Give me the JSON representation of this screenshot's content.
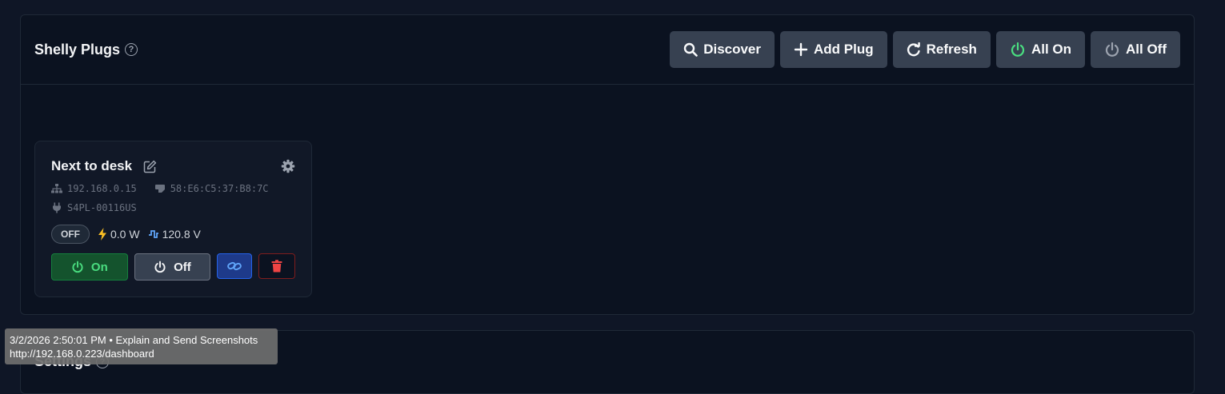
{
  "plugs_panel": {
    "title": "Shelly Plugs",
    "help": "?",
    "toolbar": {
      "discover": "Discover",
      "add_plug": "Add Plug",
      "refresh": "Refresh",
      "all_on": "All On",
      "all_off": "All Off"
    }
  },
  "plug": {
    "name": "Next to desk",
    "ip": "192.168.0.15",
    "mac": "58:E6:C5:37:B8:7C",
    "model": "S4PL-00116US",
    "state": "OFF",
    "power": "0.0 W",
    "voltage": "120.8 V",
    "on_label": "On",
    "off_label": "Off"
  },
  "settings_panel": {
    "title": "Settings",
    "help": "?"
  },
  "tooltip": {
    "line1": "3/2/2026 2:50:01 PM • Explain and Send Screenshots",
    "line2": "http://192.168.0.223/dashboard"
  },
  "colors": {
    "accent_green": "#4ade80",
    "accent_blue": "#3b82f6",
    "danger_red": "#ef4444",
    "power_yellow": "#fbbf24"
  },
  "icons": [
    "help-icon",
    "search-icon",
    "plus-icon",
    "refresh-icon",
    "power-icon",
    "edit-icon",
    "gear-icon",
    "network-icon",
    "chip-icon",
    "plug-icon",
    "bolt-icon",
    "wave-icon",
    "link-icon",
    "trash-icon"
  ]
}
